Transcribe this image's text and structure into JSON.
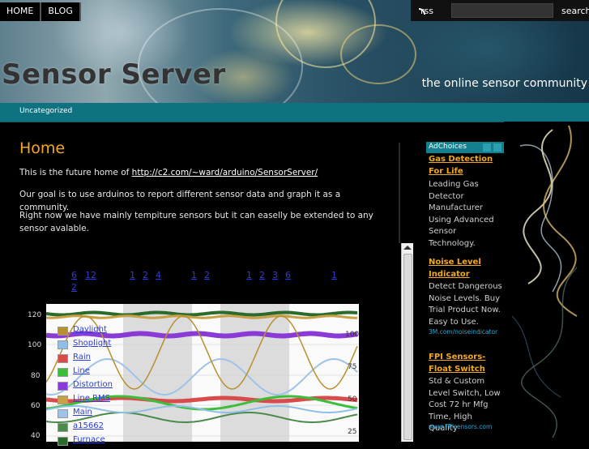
{
  "nav": {
    "items": [
      "HOME",
      "BLOG"
    ]
  },
  "topbar": {
    "rss_label": "rss",
    "search_placeholder": "",
    "search_button": "search"
  },
  "site": {
    "title": "Sensor Server",
    "tagline": "the online sensor community"
  },
  "categories": [
    "Uncategorized"
  ],
  "post": {
    "title": "Home",
    "p1_prefix": "This is the future home of ",
    "p1_link": "http://c2.com/~ward/arduino/SensorServer/",
    "p2": "Our goal is to use arduinos to report different sensor data and graph it as a community.",
    "p3": "Right now we have mainly tempiture sensors but it can easelly be extended to any sensor avalable."
  },
  "range_links": [
    {
      "label": "6",
      "group": "a"
    },
    {
      "label": "12",
      "group": "a"
    },
    {
      "label": "2",
      "group": "a2"
    },
    {
      "label": "1",
      "group": "b"
    },
    {
      "label": "2",
      "group": "b"
    },
    {
      "label": "4",
      "group": "b"
    },
    {
      "label": "1",
      "group": "c"
    },
    {
      "label": "2",
      "group": "c"
    },
    {
      "label": "1",
      "group": "d"
    },
    {
      "label": "2",
      "group": "d"
    },
    {
      "label": "3",
      "group": "d"
    },
    {
      "label": "6",
      "group": "d"
    },
    {
      "label": "1",
      "group": "e"
    }
  ],
  "chart_data": {
    "type": "line",
    "left_axis_ticks": [
      "120",
      "100",
      "80",
      "60",
      "40"
    ],
    "right_axis_ticks": [
      "100",
      "75",
      "50",
      "25"
    ],
    "series": [
      {
        "name": "Daylight",
        "color": "#b8902e"
      },
      {
        "name": "Shoplight",
        "color": "#8fbfe6"
      },
      {
        "name": "Rain",
        "color": "#d94b4b"
      },
      {
        "name": "Line",
        "color": "#3bbf3b"
      },
      {
        "name": "Distortion",
        "color": "#8a3ad6"
      },
      {
        "name": "Line RMS",
        "color": "#c8a046"
      },
      {
        "name": "Main",
        "color": "#9fc3e8"
      },
      {
        "name": "a15662",
        "color": "#4a8a4a"
      },
      {
        "name": "Furnace",
        "color": "#2a6a2a"
      }
    ]
  },
  "ad": {
    "adchoices_label": "AdChoices",
    "ads": [
      {
        "title": "Gas Detection For Life",
        "body": "Leading Gas Detector Manufacturer Using Advanced Sensor Technology.",
        "url": ""
      },
      {
        "title": "Noise Level Indicator",
        "body": "Detect Dangerous Noise Levels. Buy Trial Product Now. Easy to Use.",
        "url": "3M.com/noiseindicator"
      },
      {
        "title": "FPI Sensors-Float Switch",
        "body": "Std & Custom Level Switch, Low Cost 72 hr Mfg Time, High Quality",
        "url": "www.FPIsensors.com"
      }
    ]
  }
}
